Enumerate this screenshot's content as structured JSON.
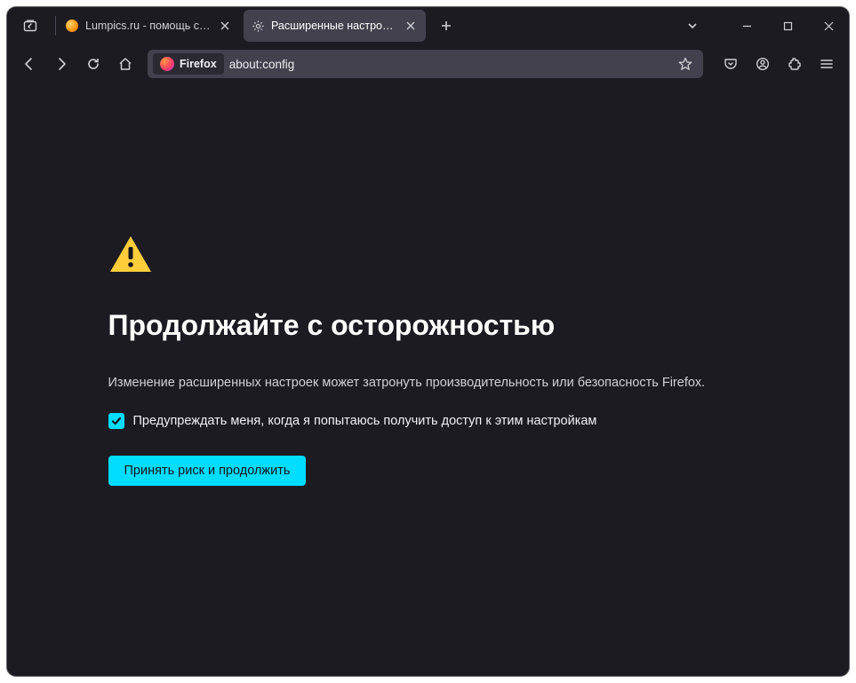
{
  "tabs": [
    {
      "label": "Lumpics.ru - помощь с компь",
      "favicon": "lumpics"
    },
    {
      "label": "Расширенные настройки",
      "favicon": "gear"
    }
  ],
  "urlbar": {
    "identity_label": "Firefox",
    "url": "about:config"
  },
  "page": {
    "heading": "Продолжайте с осторожностью",
    "description": "Изменение расширенных настроек может затронуть производительность или безопасность Firefox.",
    "checkbox_label": "Предупреждать меня, когда я попытаюсь получить доступ к этим настройкам",
    "checkbox_checked": true,
    "accept_button": "Принять риск и продолжить"
  }
}
